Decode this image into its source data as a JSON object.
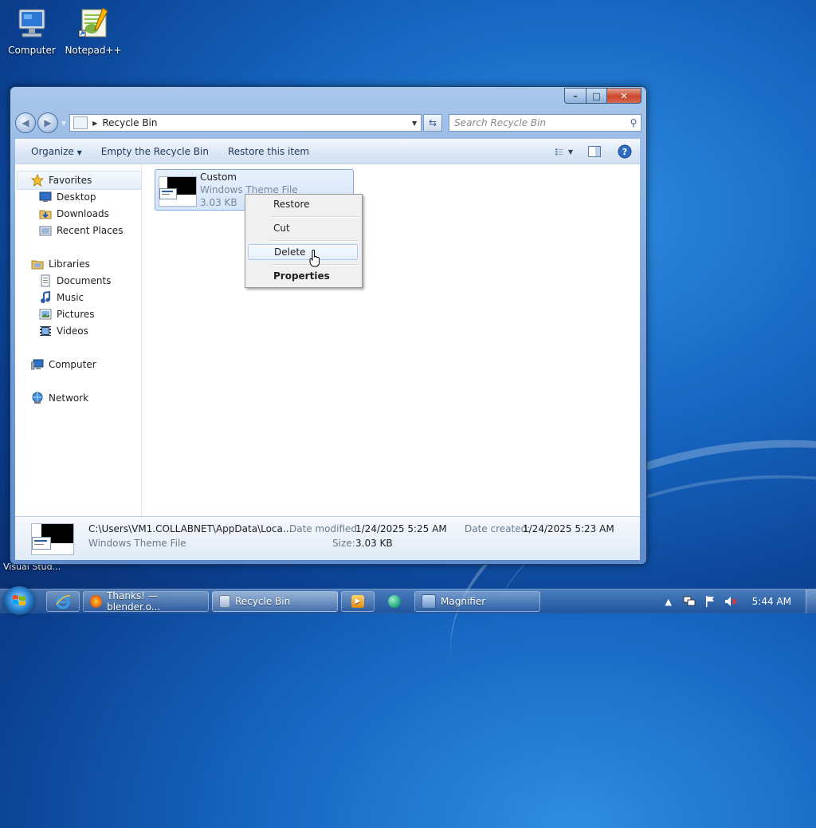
{
  "desktop": {
    "icons": [
      {
        "label": "Computer",
        "icon": "computer-icon"
      },
      {
        "label": "Notepad++",
        "icon": "notepad-plus-plus-icon"
      }
    ],
    "partial_label": "Visual Stud..."
  },
  "window": {
    "title": "Recycle Bin",
    "controls": {
      "minimize": "–",
      "maximize": "□",
      "close": "✕"
    }
  },
  "address": {
    "path": "Recycle Bin",
    "search_placeholder": "Search Recycle Bin"
  },
  "toolbar": {
    "organize": "Organize",
    "empty": "Empty the Recycle Bin",
    "restore": "Restore this item"
  },
  "nav": {
    "favorites": "Favorites",
    "desktop": "Desktop",
    "downloads": "Downloads",
    "recent": "Recent Places",
    "libraries": "Libraries",
    "documents": "Documents",
    "music": "Music",
    "pictures": "Pictures",
    "videos": "Videos",
    "computer": "Computer",
    "network": "Network"
  },
  "file": {
    "name": "Custom",
    "type": "Windows Theme File",
    "size": "3.03 KB"
  },
  "context_menu": {
    "restore": "Restore",
    "cut": "Cut",
    "delete": "Delete",
    "properties": "Properties"
  },
  "details": {
    "path": "C:\\Users\\VM1.COLLABNET\\AppData\\Loca...",
    "type": "Windows Theme File",
    "modified_label": "Date modified:",
    "modified_value": "1/24/2025 5:25 AM",
    "created_label": "Date created:",
    "created_value": "1/24/2025 5:23 AM",
    "size_label": "Size:",
    "size_value": "3.03 KB"
  },
  "taskbar": {
    "items": [
      {
        "label": "",
        "icon": "internet-explorer-icon"
      },
      {
        "label": "Thanks! — blender.o...",
        "icon": "firefox-icon"
      },
      {
        "label": "Recycle Bin",
        "icon": "recycle-bin-icon"
      },
      {
        "label": "",
        "icon": "media-player-icon"
      },
      {
        "label": "",
        "icon": "app-icon"
      },
      {
        "label": "Magnifier",
        "icon": "magnifier-icon"
      }
    ],
    "clock": "5:44 AM"
  },
  "colors": {
    "desktop_bg": "#1565c0",
    "selection": "#d5e5fa",
    "accent": "#1e395b"
  }
}
